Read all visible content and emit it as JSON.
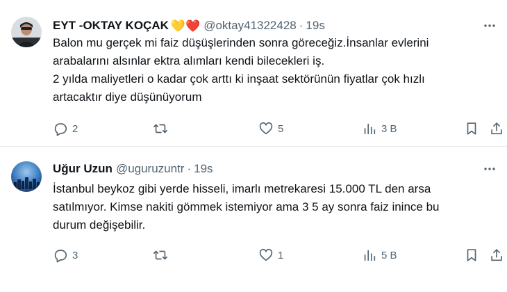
{
  "tweets": [
    {
      "name": "EYT -OKTAY KOÇAK",
      "emojis": "💛❤️",
      "handle": "@oktay41322428",
      "separator": "·",
      "time": "19s",
      "more_icon": "more-horizontal-icon",
      "lines": [
        "Balon mu gerçek mi faiz düşüşlerinden sonra göreceğiz.İnsanlar evlerini",
        "arabalarını alsınlar ektra alımları kendi bilecekleri iş.",
        "2 yılda maliyetleri o kadar çok arttı ki inşaat sektörünün fiyatlar çok hızlı",
        "artacaktır diye düşünüyorum"
      ],
      "replies": "2",
      "retweets": "",
      "likes": "5",
      "views": "3 B"
    },
    {
      "name": "Uğur Uzun",
      "emojis": "",
      "handle": "@uguruzuntr",
      "separator": "·",
      "time": "19s",
      "more_icon": "more-horizontal-icon",
      "lines": [
        "İstanbul beykoz gibi yerde hisseli, imarlı metrekaresi 15.000 TL den arsa",
        "satılmıyor. Kimse nakiti gömmek istemiyor ama 3 5 ay sonra faiz inince bu",
        "durum değişebilir."
      ],
      "replies": "3",
      "retweets": "",
      "likes": "1",
      "views": "5 B"
    }
  ],
  "colors": {
    "text": "#0f1419",
    "secondary": "#536471",
    "divider": "#e6e9ec"
  }
}
